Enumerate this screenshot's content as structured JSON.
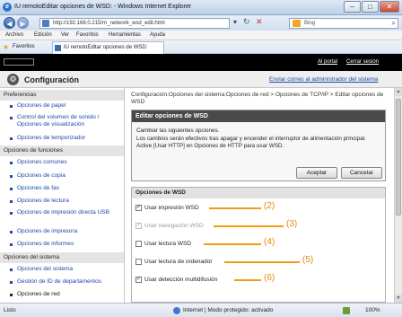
{
  "window": {
    "title": "IU remotoEditar opciones de WSD: - Windows Internet Explorer",
    "title_redacted_part": "████████████"
  },
  "address": {
    "url": "http://192.168.0.215/rn_network_wsd_edit.html",
    "search_engine": "Bing"
  },
  "menu": [
    "Archivo",
    "Edición",
    "Ver",
    "Favoritos",
    "Herramientas",
    "Ayuda"
  ],
  "favorites": {
    "label": "Favoritos",
    "tab": "IU remotoEditar opciones de WSD:"
  },
  "header": {
    "portal_link": "Al portal",
    "logout_link": "Cerrar sesión"
  },
  "config": {
    "title": "Configuración",
    "mail_link": "Enviar correo al administrador del sistema"
  },
  "sidebar": {
    "sections": [
      "Preferencias",
      "Opciones de funciones",
      "Opciones del sistema"
    ],
    "preferencias": [
      "Opciones de papel",
      "Control del volumen de sonido / Opciones de visualización",
      "Opciones de temporizador"
    ],
    "funciones": [
      "Opciones comunes",
      "Opciones de copia",
      "Opciones de fax",
      "Opciones de lectura",
      "Opciones de impresión directa USB",
      "Opciones de impresora",
      "Opciones de informes"
    ],
    "sistema": [
      "Opciones del sistema",
      "Gestión de ID de departamentos",
      "Opciones de red"
    ]
  },
  "main": {
    "breadcrumb": "Configuración:Opciones del sistema:Opciones de red > Opciones de TCP/IP > Editar opciones de WSD",
    "edit_title": "Editar opciones de WSD",
    "message_lines": [
      "Cambiar las siguientes opciones.",
      "Los cambios serán efectivos tras apagar y encender el interruptor de alimentación principal.",
      "Active [Usar HTTP] en Opciones de HTTP para usar WSD."
    ],
    "ok_button": "Aceptar",
    "cancel_button": "Cancelar",
    "section_title": "Opciones de WSD",
    "options": [
      {
        "label": "Usar impresión WSD",
        "checked": true,
        "enabled": true,
        "callout": "(2)"
      },
      {
        "label": "Usar navegación WSD",
        "checked": true,
        "enabled": false,
        "callout": "(3)"
      },
      {
        "label": "Usar lectura WSD",
        "checked": false,
        "enabled": true,
        "callout": "(4)"
      },
      {
        "label": "Usar lectura de ordenador",
        "checked": false,
        "enabled": true,
        "callout": "(5)"
      },
      {
        "label": "Usar detección multidifusión",
        "checked": true,
        "enabled": true,
        "callout": "(6)"
      }
    ]
  },
  "status": {
    "left": "Listo",
    "zone": "Internet | Modo protegido: activado",
    "zoom": "100%"
  },
  "colors": {
    "accent": "#f39c12",
    "link": "#1a4aa8",
    "header_bg": "#000000"
  }
}
